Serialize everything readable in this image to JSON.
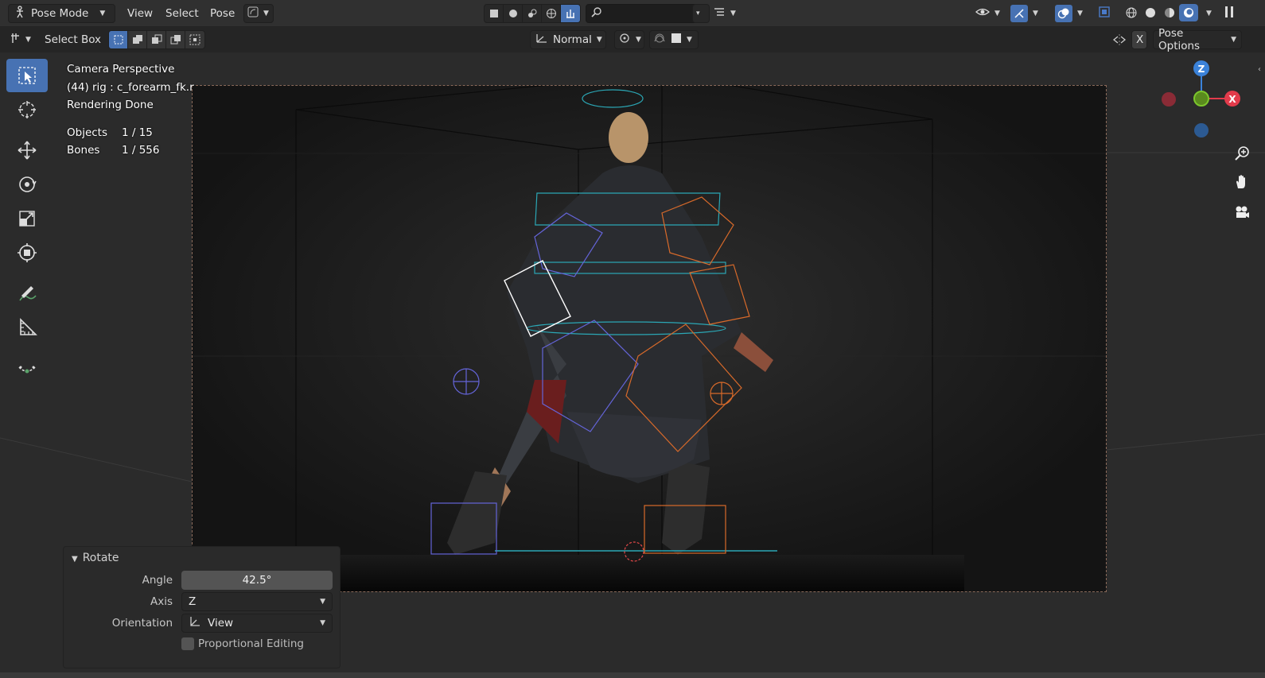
{
  "header": {
    "mode_label": "Pose Mode",
    "menus": [
      "View",
      "Select",
      "Pose"
    ],
    "search_placeholder": ""
  },
  "tool_header": {
    "tool_name": "Select Box",
    "transform_orientation": "Normal",
    "pose_options_label": "Pose Options",
    "x_mirror_label": "X"
  },
  "viewport": {
    "view_name": "Camera Perspective",
    "active_object": "(44) rig : c_forearm_fk.r",
    "render_status": "Rendering Done",
    "stats": [
      {
        "label": "Objects",
        "value": "1 / 15"
      },
      {
        "label": "Bones",
        "value": "1 / 556"
      }
    ]
  },
  "gizmo": {
    "z_label": "Z",
    "x_label": "X"
  },
  "operator_panel": {
    "title": "Rotate",
    "angle_label": "Angle",
    "angle_value": "42.5°",
    "axis_label": "Axis",
    "axis_value": "Z",
    "orientation_label": "Orientation",
    "orientation_value": "View",
    "proportional_label": "Proportional Editing",
    "proportional_checked": false
  },
  "colors": {
    "accent": "#4772b3",
    "header_bg": "#303030",
    "viewport_bg": "#2b2b2b",
    "axis_x": "#e23b4b",
    "axis_y": "#7cc72c",
    "axis_z": "#3b82d9"
  }
}
